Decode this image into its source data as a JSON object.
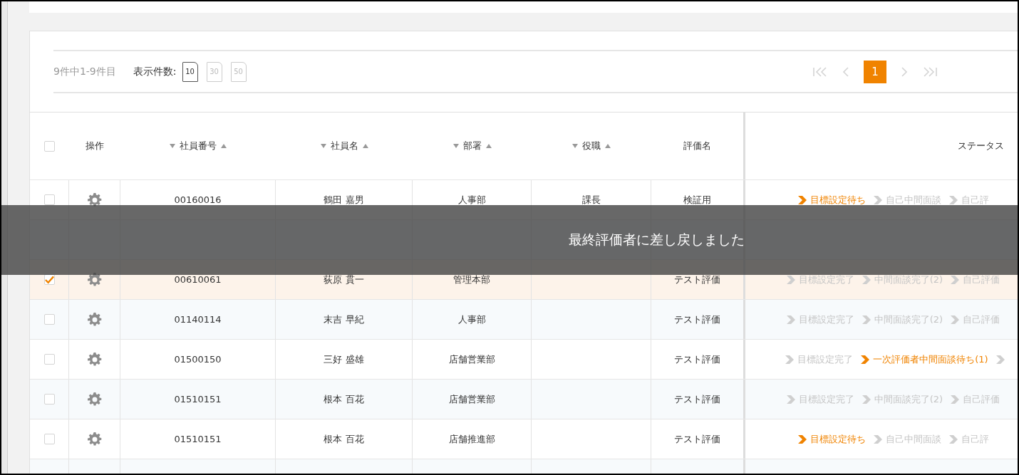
{
  "toolbar": {
    "count_text": "9件中1-9件目",
    "page_size_label": "表示件数:",
    "page_sizes": [
      {
        "label": "10",
        "selected": true
      },
      {
        "label": "30",
        "selected": false
      },
      {
        "label": "50",
        "selected": false
      }
    ],
    "pages": [
      {
        "label": "1",
        "selected": true
      }
    ]
  },
  "table": {
    "select_all_checked": false,
    "columns": [
      {
        "kind": "checkbox"
      },
      {
        "label": "操作",
        "kind": "plain"
      },
      {
        "label": "社員番号",
        "kind": "sortable"
      },
      {
        "label": "社員名",
        "kind": "sortable"
      },
      {
        "label": "部署",
        "kind": "sortable"
      },
      {
        "label": "役職",
        "kind": "sortable"
      },
      {
        "label": "評価名",
        "kind": "plain"
      },
      {
        "label": "ステータス",
        "kind": "status"
      }
    ],
    "rows": [
      {
        "checked": false,
        "employee_no": "00160016",
        "name": "鶴田 嘉男",
        "department": "人事部",
        "position": "課長",
        "evaluation": "検証用",
        "status": [
          {
            "label": "目標設定待ち",
            "current": true
          },
          {
            "label": "自己中間面談",
            "current": false
          },
          {
            "label": "自己評",
            "current": false
          }
        ]
      },
      {
        "kind": "covered"
      },
      {
        "checked": true,
        "employee_no": "00610061",
        "name": "荻原 貫一",
        "department": "管理本部",
        "evaluation": "テスト評価",
        "status": [
          {
            "label": "目標設定完了",
            "current": false
          },
          {
            "label": "中間面談完了(2)",
            "current": false
          },
          {
            "label": "自己評価",
            "current": false
          }
        ]
      },
      {
        "checked": false,
        "employee_no": "01140114",
        "name": "末吉 早紀",
        "department": "人事部",
        "evaluation": "テスト評価",
        "status": [
          {
            "label": "目標設定完了",
            "current": false
          },
          {
            "label": "中間面談完了(2)",
            "current": false
          },
          {
            "label": "自己評価",
            "current": false
          }
        ]
      },
      {
        "checked": false,
        "employee_no": "01500150",
        "name": "三好 盛雄",
        "department": "店舗営業部",
        "evaluation": "テスト評価",
        "status": [
          {
            "label": "目標設定完了",
            "current": false
          },
          {
            "label": "一次評価者中間面談待ち(1)",
            "current": true
          },
          {
            "current": false
          }
        ]
      },
      {
        "checked": false,
        "employee_no": "01510151",
        "name": "根本 百花",
        "department": "店舗営業部",
        "evaluation": "テスト評価",
        "status": [
          {
            "label": "目標設定完了",
            "current": false
          },
          {
            "label": "中間面談完了(2)",
            "current": false
          },
          {
            "label": "自己評価",
            "current": false
          }
        ]
      },
      {
        "checked": false,
        "employee_no": "01510151",
        "name": "根本 百花",
        "department": "店舗推進部",
        "evaluation": "テスト評価",
        "status": [
          {
            "label": "目標設定待ち",
            "current": true
          },
          {
            "label": "自己中間面談",
            "current": false
          },
          {
            "label": "自己評",
            "current": false
          }
        ]
      }
    ]
  },
  "toast": {
    "message": "最終評価者に差し戻しました"
  }
}
